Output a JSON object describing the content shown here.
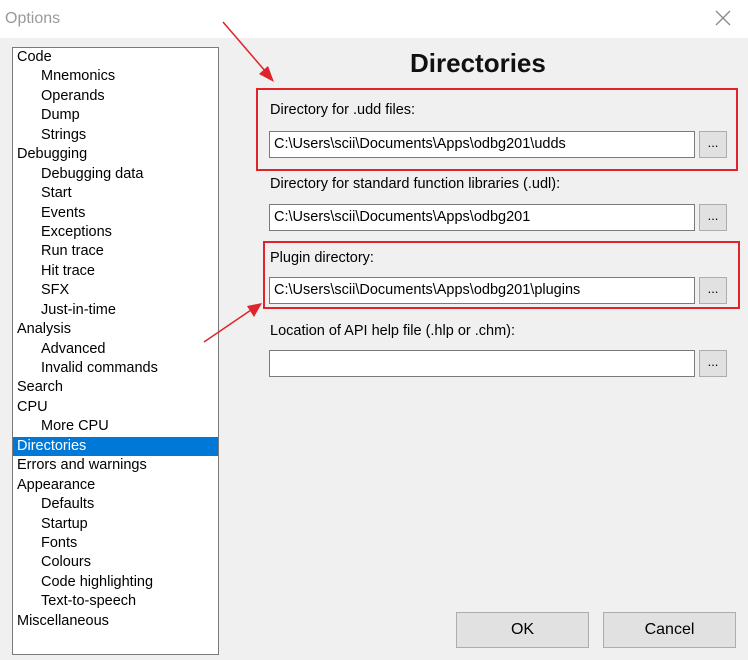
{
  "window": {
    "title": "Options"
  },
  "tree": {
    "items": [
      {
        "label": "Code",
        "level": 0
      },
      {
        "label": "Mnemonics",
        "level": 1
      },
      {
        "label": "Operands",
        "level": 1
      },
      {
        "label": "Dump",
        "level": 1
      },
      {
        "label": "Strings",
        "level": 1
      },
      {
        "label": "Debugging",
        "level": 0
      },
      {
        "label": "Debugging data",
        "level": 1
      },
      {
        "label": "Start",
        "level": 1
      },
      {
        "label": "Events",
        "level": 1
      },
      {
        "label": "Exceptions",
        "level": 1
      },
      {
        "label": "Run trace",
        "level": 1
      },
      {
        "label": "Hit trace",
        "level": 1
      },
      {
        "label": "SFX",
        "level": 1
      },
      {
        "label": "Just-in-time",
        "level": 1
      },
      {
        "label": "Analysis",
        "level": 0
      },
      {
        "label": "Advanced",
        "level": 1
      },
      {
        "label": "Invalid commands",
        "level": 1
      },
      {
        "label": "Search",
        "level": 0
      },
      {
        "label": "CPU",
        "level": 0
      },
      {
        "label": "More CPU",
        "level": 1
      },
      {
        "label": "Directories",
        "level": 0,
        "selected": true
      },
      {
        "label": "Errors and warnings",
        "level": 0
      },
      {
        "label": "Appearance",
        "level": 0
      },
      {
        "label": "Defaults",
        "level": 1
      },
      {
        "label": "Startup",
        "level": 1
      },
      {
        "label": "Fonts",
        "level": 1
      },
      {
        "label": "Colours",
        "level": 1
      },
      {
        "label": "Code highlighting",
        "level": 1
      },
      {
        "label": "Text-to-speech",
        "level": 1
      },
      {
        "label": "Miscellaneous",
        "level": 0
      }
    ]
  },
  "panel": {
    "heading": "Directories",
    "udd": {
      "label": "Directory for .udd files:",
      "value": "C:\\Users\\scii\\Documents\\Apps\\odbg201\\udds",
      "browse": "..."
    },
    "udl": {
      "label": "Directory for standard function libraries (.udl):",
      "value": "C:\\Users\\scii\\Documents\\Apps\\odbg201",
      "browse": "..."
    },
    "plugin": {
      "label": "Plugin directory:",
      "value": "C:\\Users\\scii\\Documents\\Apps\\odbg201\\plugins",
      "browse": "..."
    },
    "api_help": {
      "label": "Location of API help file (.hlp or .chm):",
      "value": "",
      "browse": "..."
    }
  },
  "buttons": {
    "ok": "OK",
    "cancel": "Cancel"
  },
  "colors": {
    "annotation": "#e0242b",
    "selection": "#0078d7"
  }
}
